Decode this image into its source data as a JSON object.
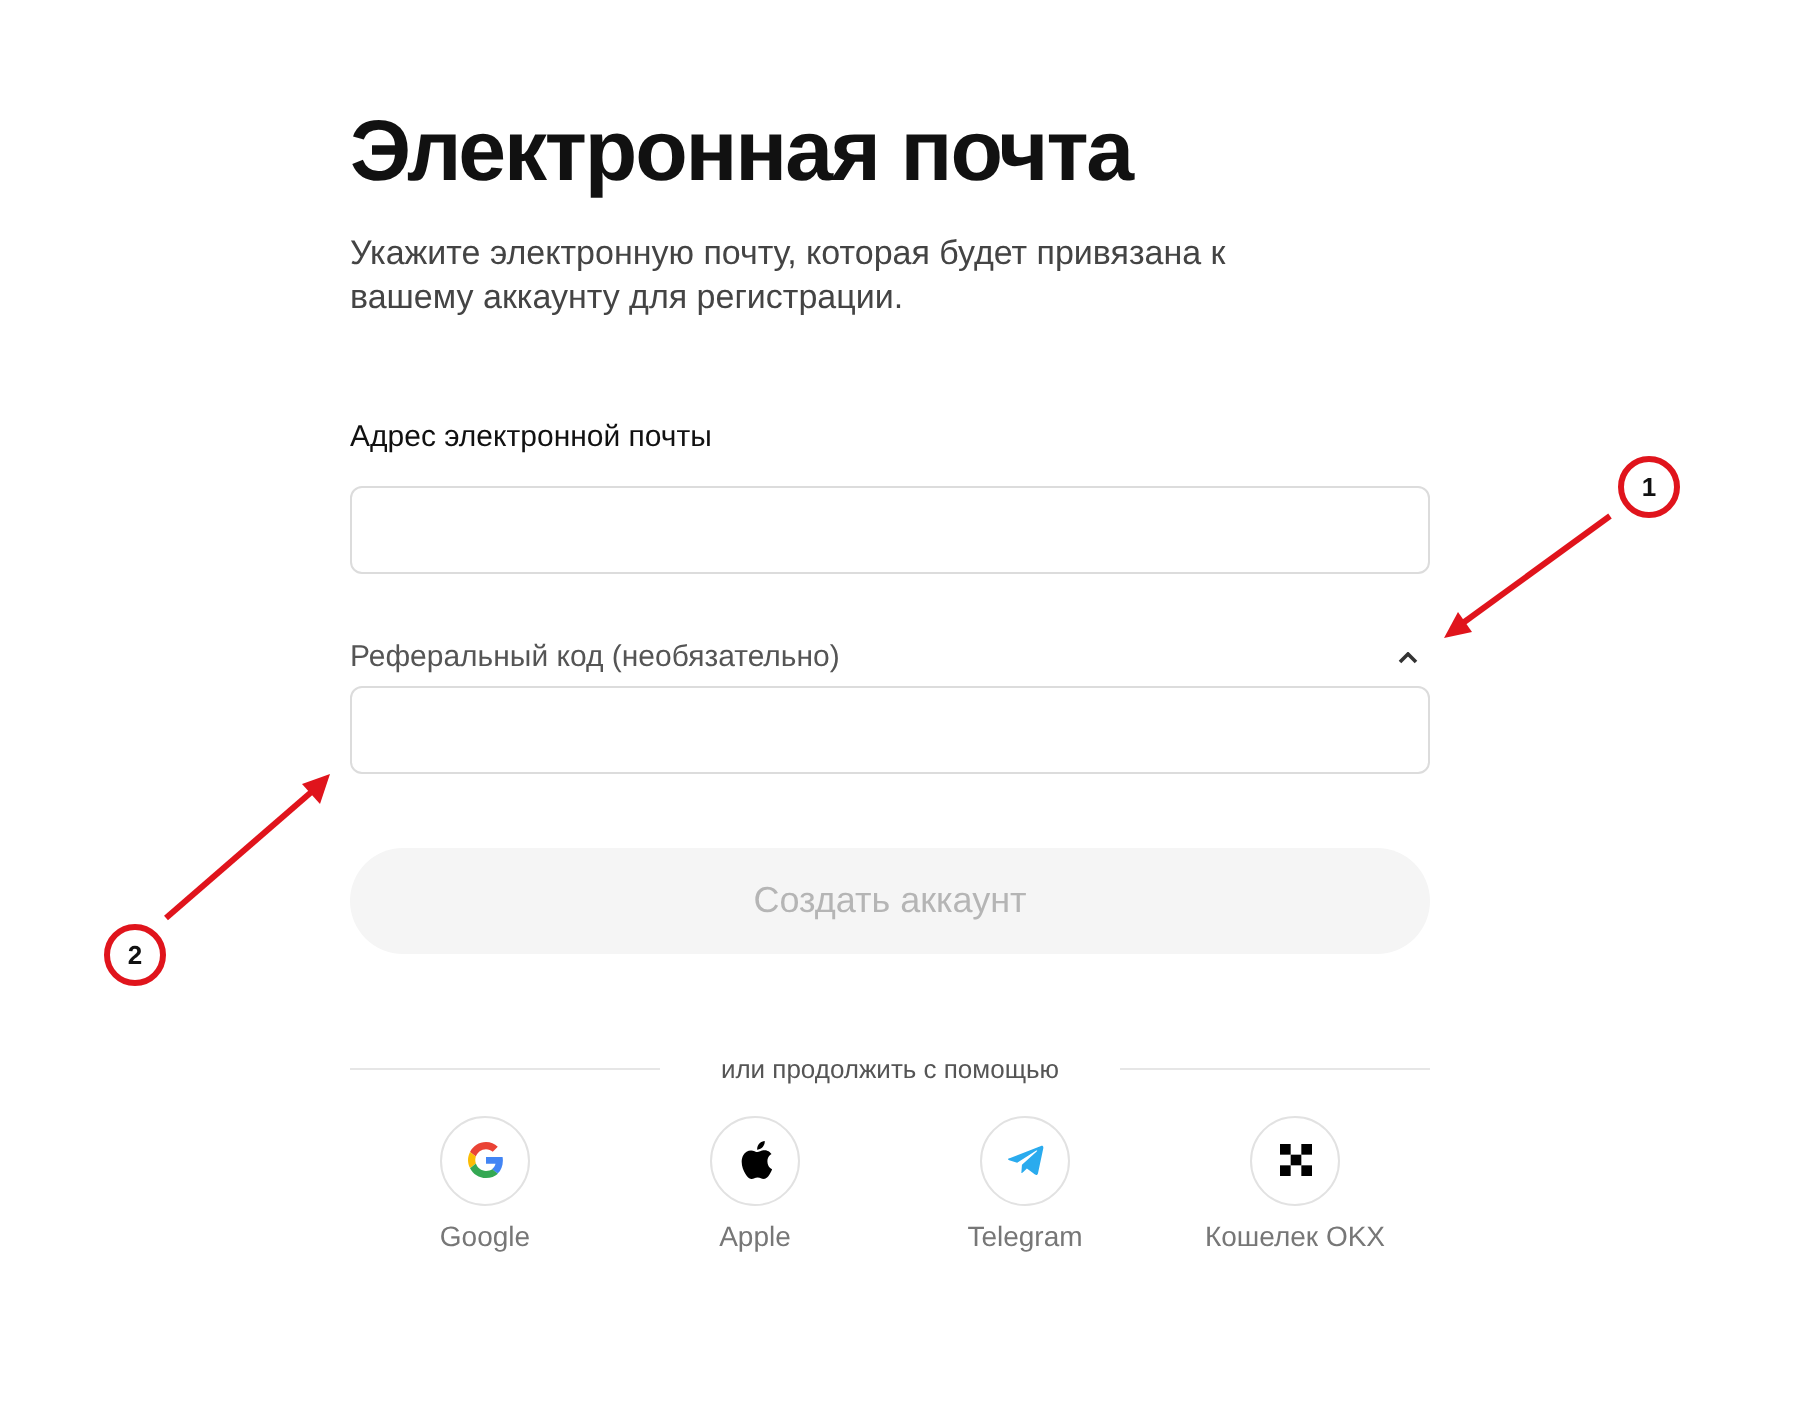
{
  "title": "Электронная почта",
  "subtitle": "Укажите электронную почту, которая будет привязана к вашему аккаунту для регистрации.",
  "email_field": {
    "label": "Адрес электронной почты"
  },
  "referral_field": {
    "label": "Реферальный код (необязательно)",
    "expanded": true
  },
  "submit_button": {
    "label": "Создать аккаунт",
    "disabled": true
  },
  "divider_text": "или продолжить с помощью",
  "providers": [
    {
      "kind": "google",
      "label": "Google"
    },
    {
      "kind": "apple",
      "label": "Apple"
    },
    {
      "kind": "telegram",
      "label": "Telegram"
    },
    {
      "kind": "okx",
      "label": "Кошелек OKX"
    }
  ],
  "annotations": [
    {
      "label": "1"
    },
    {
      "label": "2"
    }
  ]
}
